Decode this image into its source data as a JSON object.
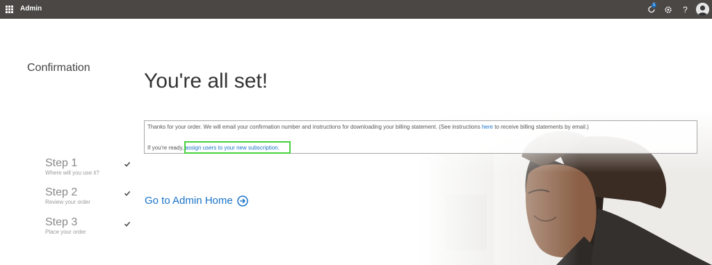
{
  "topbar": {
    "title": "Admin",
    "notification_count": "1",
    "icons": [
      "app-launcher-icon",
      "notification-icon",
      "gear-icon",
      "help-icon",
      "avatar"
    ],
    "help_glyph": "?"
  },
  "sidebar": {
    "title": "Confirmation",
    "steps": [
      {
        "title": "Step 1",
        "subtitle": "Where will you use it?"
      },
      {
        "title": "Step 2",
        "subtitle": "Review your order"
      },
      {
        "title": "Step 3",
        "subtitle": "Place your order"
      }
    ]
  },
  "main": {
    "heading": "You're all set!",
    "message_part1": "Thanks for your order. We will email your confirmation number and instructions for downloading your billing statement. (See instructions ",
    "message_link": "here",
    "message_part2": " to receive billing statements by email.)",
    "ready_prefix": "If you're ready, ",
    "ready_link": "assign users to your new subscription.",
    "go_home": "Go to Admin Home"
  },
  "colors": {
    "topbar": "#4a4744",
    "link": "#1a73c8",
    "highlight": "#45d23d"
  }
}
